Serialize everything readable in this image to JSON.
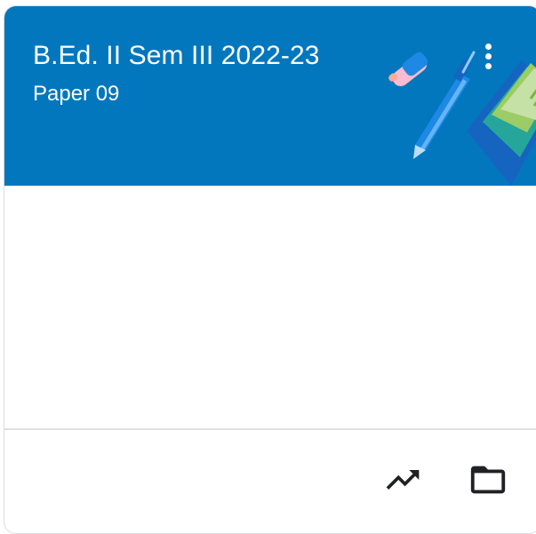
{
  "class_card": {
    "title": "B.Ed. II Sem III 2022-23",
    "section": "Paper 09",
    "header_color": "#0277bd",
    "more_options_icon": "more-vert-icon",
    "footer_icons": [
      "trending-up-icon",
      "folder-icon"
    ]
  }
}
